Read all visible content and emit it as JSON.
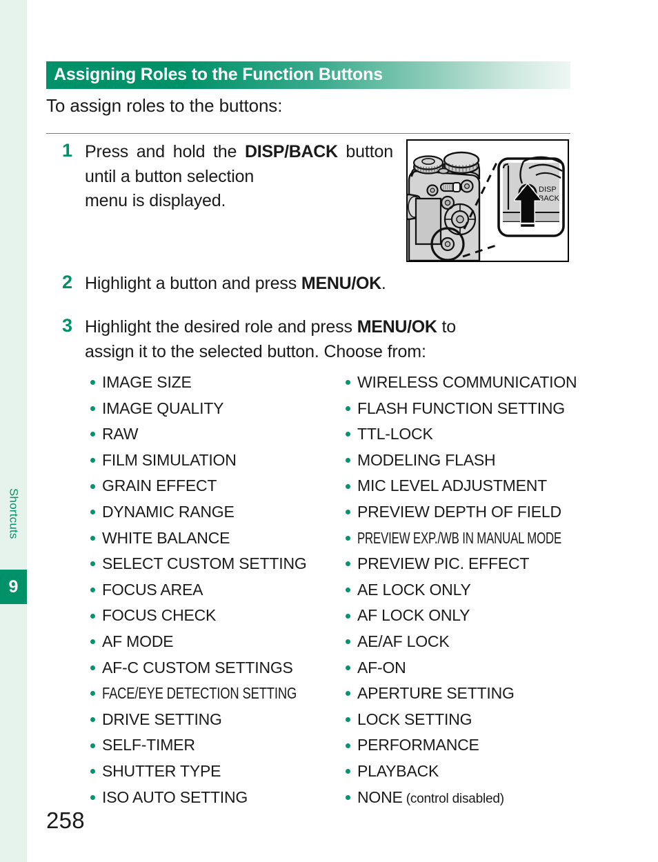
{
  "sidebar": {
    "chapter_label": "Shortcuts",
    "chapter_number": "9"
  },
  "header": {
    "title": "Assigning Roles to the Function Buttons"
  },
  "intro": {
    "text": "To assign roles to the buttons:"
  },
  "steps": [
    {
      "number": "1",
      "text_part1": "Press and hold the ",
      "text_bold": "DISP/BACK",
      "text_part2": " button until a button selection",
      "text_lastline": "menu is displayed."
    },
    {
      "number": "2",
      "text_part1": "Highlight a button and press ",
      "text_bold": "MENU/OK",
      "text_part2": "."
    },
    {
      "number": "3",
      "text_part1": "Highlight the desired role and press ",
      "text_bold": "MENU/OK",
      "text_part2": " to",
      "text_lastline": "assign it to the selected button. Choose from:"
    }
  ],
  "illustration": {
    "name": "camera-disp-back-button-diagram",
    "callout_label_line1": "DISP",
    "callout_label_line2": "BACK"
  },
  "roles_left": [
    "IMAGE SIZE",
    "IMAGE QUALITY",
    "RAW",
    "FILM SIMULATION",
    "GRAIN EFFECT",
    "DYNAMIC RANGE",
    "WHITE BALANCE",
    "SELECT CUSTOM SETTING",
    "FOCUS AREA",
    "FOCUS CHECK",
    "AF MODE",
    "AF-C CUSTOM SETTINGS",
    "FACE/EYE DETECTION SETTING",
    "DRIVE SETTING",
    "SELF-TIMER",
    "SHUTTER TYPE",
    "ISO AUTO SETTING"
  ],
  "roles_right": [
    "WIRELESS COMMUNICATION",
    "FLASH FUNCTION SETTING",
    "TTL-LOCK",
    "MODELING FLASH",
    "MIC LEVEL ADJUSTMENT",
    "PREVIEW DEPTH OF FIELD",
    "PREVIEW EXP./WB IN MANUAL MODE",
    "PREVIEW PIC. EFFECT",
    "AE LOCK ONLY",
    "AF LOCK ONLY",
    "AE/AF LOCK",
    "AF-ON",
    "APERTURE SETTING",
    "LOCK SETTING",
    "PERFORMANCE",
    "PLAYBACK",
    "NONE"
  ],
  "roles_right_none_suffix": " (control disabled)",
  "page_number": "258",
  "colors": {
    "brand_green": "#009169",
    "sidebar_mint": "#e6f2ec",
    "bullet_green": "#00956e",
    "text_black": "#1a1a1a"
  }
}
